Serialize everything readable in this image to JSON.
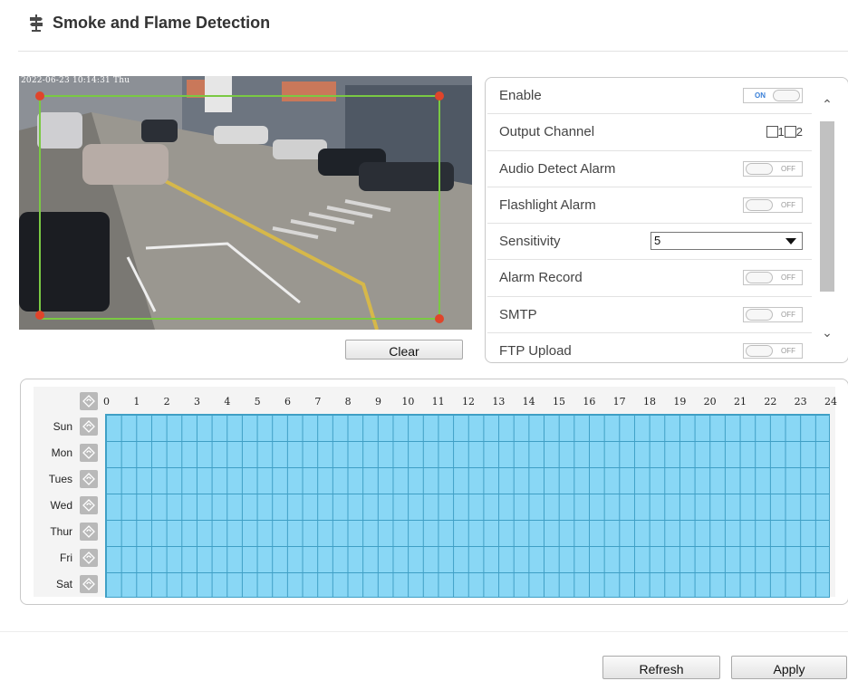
{
  "header": {
    "title": "Smoke and Flame Detection",
    "icon": "signpost-icon"
  },
  "video": {
    "timestamp": "2022-06-23 10:14:31 Thu",
    "detection_area_color": "#7ac943",
    "corner_handle_color": "#e0442a"
  },
  "clear_label": "Clear",
  "settings": {
    "enable": {
      "label": "Enable",
      "state": "ON"
    },
    "output_channel": {
      "label": "Output Channel",
      "options": [
        "1",
        "2"
      ],
      "checked": [
        false,
        false
      ]
    },
    "audio_detect_alarm": {
      "label": "Audio Detect Alarm",
      "state": "OFF"
    },
    "flashlight_alarm": {
      "label": "Flashlight Alarm",
      "state": "OFF"
    },
    "sensitivity": {
      "label": "Sensitivity",
      "value": "5"
    },
    "alarm_record": {
      "label": "Alarm Record",
      "state": "OFF"
    },
    "smtp": {
      "label": "SMTP",
      "state": "OFF"
    },
    "ftp_upload": {
      "label": "FTP Upload",
      "state": "OFF"
    }
  },
  "schedule": {
    "hours": [
      "0",
      "1",
      "2",
      "3",
      "4",
      "5",
      "6",
      "7",
      "8",
      "9",
      "10",
      "11",
      "12",
      "13",
      "14",
      "15",
      "16",
      "17",
      "18",
      "19",
      "20",
      "21",
      "22",
      "23",
      "24"
    ],
    "days": [
      "Sun",
      "Mon",
      "Tues",
      "Wed",
      "Thur",
      "Fri",
      "Sat"
    ],
    "fill_color": "#89d7f5",
    "line_color": "#3f9fc5",
    "all_selected": true
  },
  "footer": {
    "refresh_label": "Refresh",
    "apply_label": "Apply"
  }
}
